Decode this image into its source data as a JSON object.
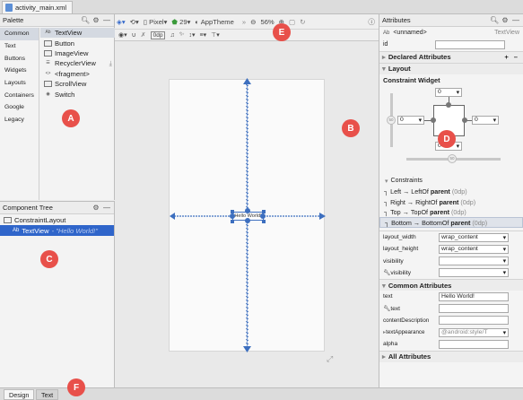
{
  "file_tab": {
    "label": "activity_main.xml"
  },
  "palette": {
    "title": "Palette",
    "categories": [
      "Common",
      "Text",
      "Buttons",
      "Widgets",
      "Layouts",
      "Containers",
      "Google",
      "Legacy"
    ],
    "selected_category": "Common",
    "items": [
      {
        "prefix": "Ab",
        "label": "TextView"
      },
      {
        "prefix": "",
        "label": "Button"
      },
      {
        "prefix": "",
        "label": "ImageView"
      },
      {
        "prefix": "",
        "label": "RecyclerView"
      },
      {
        "prefix": "<>",
        "label": "<fragment>"
      },
      {
        "prefix": "",
        "label": "ScrollView"
      },
      {
        "prefix": "",
        "label": "Switch"
      }
    ]
  },
  "component_tree": {
    "title": "Component Tree",
    "root": "ConstraintLayout",
    "child_prefix": "Ab",
    "child": "TextView",
    "child_hint": "- \"Hello World!\""
  },
  "toolbar": {
    "device": "Pixel",
    "api": "29",
    "theme": "AppTheme",
    "zoom": "56%",
    "margin": "0dp"
  },
  "canvas": {
    "textview_text": "Hello World!"
  },
  "attributes": {
    "title": "Attributes",
    "class_prefix": "Ab",
    "name": "<unnamed>",
    "class_name": "TextView",
    "id_label": "id",
    "declared_label": "Declared Attributes",
    "layout_label": "Layout",
    "constraint_widget_label": "Constraint Widget",
    "margins": {
      "top": "0",
      "left": "0",
      "right": "0",
      "bottom": "0"
    },
    "bias_value": "50",
    "constraints_label": "Constraints",
    "constraints": [
      {
        "side": "Left",
        "arrow": "→",
        "target": "LeftOf",
        "bold": "parent",
        "dp": "(0dp)"
      },
      {
        "side": "Right",
        "arrow": "→",
        "target": "RightOf",
        "bold": "parent",
        "dp": "(0dp)"
      },
      {
        "side": "Top",
        "arrow": "→",
        "target": "TopOf",
        "bold": "parent",
        "dp": "(0dp)"
      },
      {
        "side": "Bottom",
        "arrow": "→",
        "target": "BottomOf",
        "bold": "parent",
        "dp": "(0dp)"
      }
    ],
    "layout_rows": [
      {
        "label": "layout_width",
        "value": "wrap_content"
      },
      {
        "label": "layout_height",
        "value": "wrap_content"
      },
      {
        "label": "visibility",
        "value": ""
      },
      {
        "label": "visibility",
        "value": ""
      }
    ],
    "common_label": "Common Attributes",
    "common_rows": [
      {
        "label": "text",
        "value": "Hello World!"
      },
      {
        "label": "text",
        "value": ""
      },
      {
        "label": "contentDescription",
        "value": ""
      },
      {
        "label": "textAppearance",
        "value": "@android:style/T"
      },
      {
        "label": "alpha",
        "value": ""
      }
    ],
    "all_label": "All Attributes"
  },
  "bottom_tabs": {
    "design": "Design",
    "text": "Text"
  },
  "callouts": {
    "a": "A",
    "b": "B",
    "c": "C",
    "d": "D",
    "e": "E",
    "f": "F"
  },
  "colors": {
    "accent": "#2f65ca",
    "constraint": "#3d6fbf",
    "callout": "#e8504a"
  }
}
